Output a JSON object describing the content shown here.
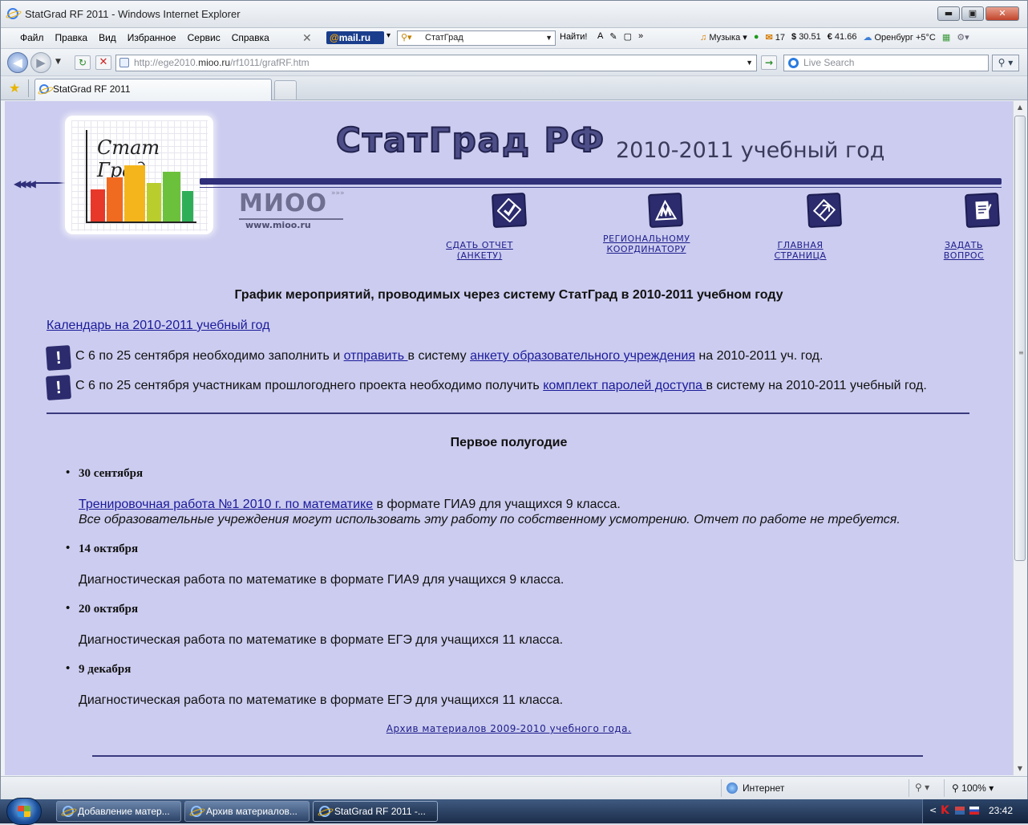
{
  "window": {
    "title": "StatGrad RF 2011 - Windows Internet Explorer",
    "controls": [
      "▬",
      "▣",
      "✕"
    ]
  },
  "menubar": {
    "items": [
      "Файл",
      "Правка",
      "Вид",
      "Избранное",
      "Сервис",
      "Справка"
    ],
    "close_glyph": "✕",
    "mailru_logo": "mail.ru",
    "search_value": "СтатГрад",
    "find_label": "Найти!",
    "tools": [
      "A",
      "✎",
      "▢",
      "»"
    ],
    "music_label": "Музыка",
    "mail_count": "17",
    "usd_rate": "30.51",
    "eur_rate": "41.66",
    "weather": "Оренбург +5°C"
  },
  "address": {
    "url_prefix": "http://ege2010.",
    "url_domain": "mioo.ru",
    "url_path": "/rf1011/grafRF.htm",
    "search_placeholder": "Live Search",
    "back_glyph": "◀",
    "forward_glyph": "▶",
    "refresh_glyph": "↻",
    "stop_glyph": "✕",
    "go_glyph": "→",
    "search_glyph": "⚲ ▾"
  },
  "tabs": {
    "items": [
      {
        "label": "StatGrad RF 2011"
      }
    ]
  },
  "header": {
    "logo_script": "Стат Град",
    "brand": "СтатГрад РФ",
    "year": "2010-2011 учебный год",
    "mioo": "МИОО",
    "mioo_url": "www.mioo.ru",
    "chevrons": "◀◀◀◀",
    "mioo_arrows": "»»»",
    "nav": [
      {
        "line1": "СДАТЬ ОТЧЕТ (АНКЕТУ)",
        "line2": ""
      },
      {
        "line1": "РЕГИОНАЛЬНОМУ",
        "line2": "КООРДИНАТОРУ"
      },
      {
        "line1": "ГЛАВНАЯ СТРАНИЦА",
        "line2": ""
      },
      {
        "line1": "ЗАДАТЬ ВОПРОС",
        "line2": ""
      }
    ]
  },
  "main": {
    "heading": "График мероприятий, проводимых через систему СтатГрад в 2010-2011 учебном году",
    "calendar_link": "Календарь на 2010-2011 учебный год",
    "notices": [
      {
        "pre": "С 6 по 25 сентября необходимо заполнить и ",
        "link1": "отправить ",
        "mid": " в систему ",
        "link2": "анкету образовательного учреждения",
        "post": " на 2010-2011 уч. год."
      },
      {
        "pre": "С 6 по 25 сентября участникам прошлогоднего проекта необходимо получить ",
        "link1": "комплект паролей доступа ",
        "post": " в систему на 2010-2011 учебный год."
      }
    ],
    "section_title": "Первое полугодие",
    "events": [
      {
        "date": "30 сентября",
        "link": "Тренировочная работа №1 2010 г. по математике",
        "text": " в формате ГИА9 для учащихся 9 класса.",
        "note": "Все образовательные учреждения могут использовать эту работу по собственному усмотрению. Отчет по работе не требуется."
      },
      {
        "date": "14 октября",
        "text": "Диагностическая работа по математике в формате ГИА9 для учащихся 9 класса."
      },
      {
        "date": "20 октября",
        "text": "Диагностическая работа по математике в формате ЕГЭ для учащихся 11 класса."
      },
      {
        "date": "9 декабря",
        "text": "Диагностическая работа по математике в формате ЕГЭ для учащихся 11 класса."
      }
    ],
    "archive_link": "Архив материалов 2009-2010 учебного года."
  },
  "statusbar": {
    "zone": "Интернет",
    "zoom": "100%",
    "protected_glyph": "⚲ ▾",
    "zoom_drop": "▾"
  },
  "taskbar": {
    "tasks": [
      {
        "label": "Добавление матер..."
      },
      {
        "label": "Архив материалов..."
      },
      {
        "label": "StatGrad RF 2011 -..."
      }
    ],
    "tray_chevron": "<",
    "tray_k": "K",
    "clock": "23:42"
  },
  "colors": {
    "page_bg": "#ccccf0",
    "brand_navy": "#2b2b6d",
    "link": "#1a1a9a"
  }
}
